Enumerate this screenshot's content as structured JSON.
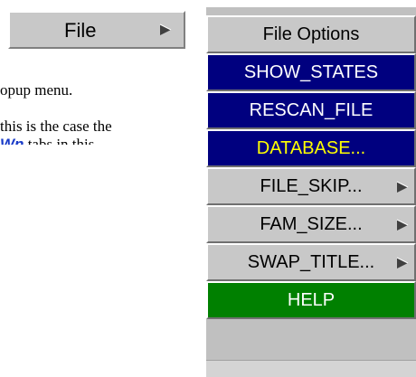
{
  "file_button": {
    "label": "File",
    "icon": "submenu-arrow-icon"
  },
  "description": {
    "line1": "opup menu.",
    "line2": "this is the case the",
    "line3_emph": "Wn",
    "line3_rest": " tabs in this"
  },
  "popup_menu": {
    "title": "File Options",
    "items": [
      {
        "label": "SHOW_STATES",
        "style": "blue",
        "submenu": false
      },
      {
        "label": "RESCAN_FILE",
        "style": "blue",
        "submenu": false
      },
      {
        "label": "DATABASE...",
        "style": "yellow",
        "submenu": false
      },
      {
        "label": "FILE_SKIP...",
        "style": "grey",
        "submenu": true
      },
      {
        "label": "FAM_SIZE...",
        "style": "grey",
        "submenu": true
      },
      {
        "label": "SWAP_TITLE...",
        "style": "grey",
        "submenu": true
      },
      {
        "label": "HELP",
        "style": "green",
        "submenu": false
      }
    ]
  },
  "colors": {
    "button_grey": "#c8c8c8",
    "menu_blue": "#00007f",
    "menu_green": "#008000",
    "highlight_yellow": "#ffff00",
    "link_blue": "#1a3cc8"
  }
}
